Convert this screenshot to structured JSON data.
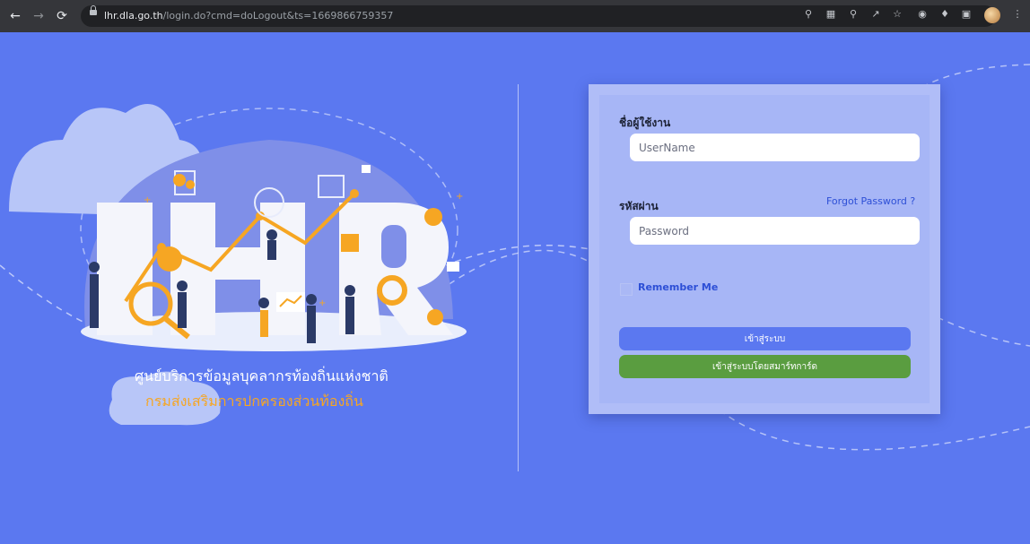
{
  "browser": {
    "url_host": "lhr.dla.go.th",
    "url_path": "/login.do?cmd=doLogout&ts=1669866759357"
  },
  "hero": {
    "logo_text": "LHR",
    "subtitle_line1": "ศูนย์บริการข้อมูลบุคลากรท้องถิ่นแห่งชาติ",
    "subtitle_line2": "กรมส่งเสริมการปกครองส่วนท้องถิ่น"
  },
  "login": {
    "username_label": "ชื่อผู้ใช้งาน",
    "username_placeholder": "UserName",
    "password_label": "รหัสผ่าน",
    "password_placeholder": "Password",
    "forgot_password": "Forgot Password ?",
    "remember_me": "Remember Me",
    "login_button": "เข้าสู่ระบบ",
    "smartcard_button": "เข้าสู่ระบบโดยสมาร์ทการ์ด"
  },
  "colors": {
    "background": "#5b78f0",
    "card": "#b0bdf7",
    "login_button": "#5b78f0",
    "smartcard_button": "#5a9d40",
    "subtitle_accent": "#f6a623"
  }
}
